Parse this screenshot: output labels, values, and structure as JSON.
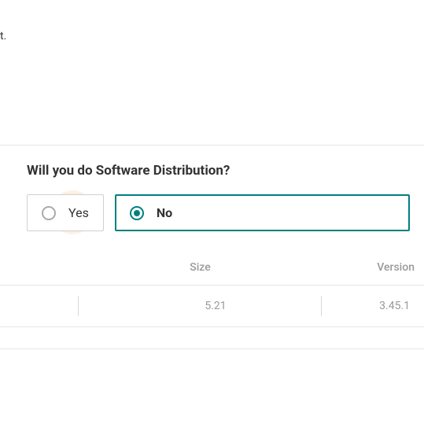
{
  "top": {
    "text_fragment": "t."
  },
  "question": {
    "title": "Will you do Software Distribution?",
    "options": {
      "yes": "Yes",
      "no": "No"
    },
    "selected": "no"
  },
  "table": {
    "headers": {
      "size": "Size",
      "version": "Version"
    },
    "rows": [
      {
        "size": "5.21",
        "version": "3.45.1"
      }
    ]
  }
}
